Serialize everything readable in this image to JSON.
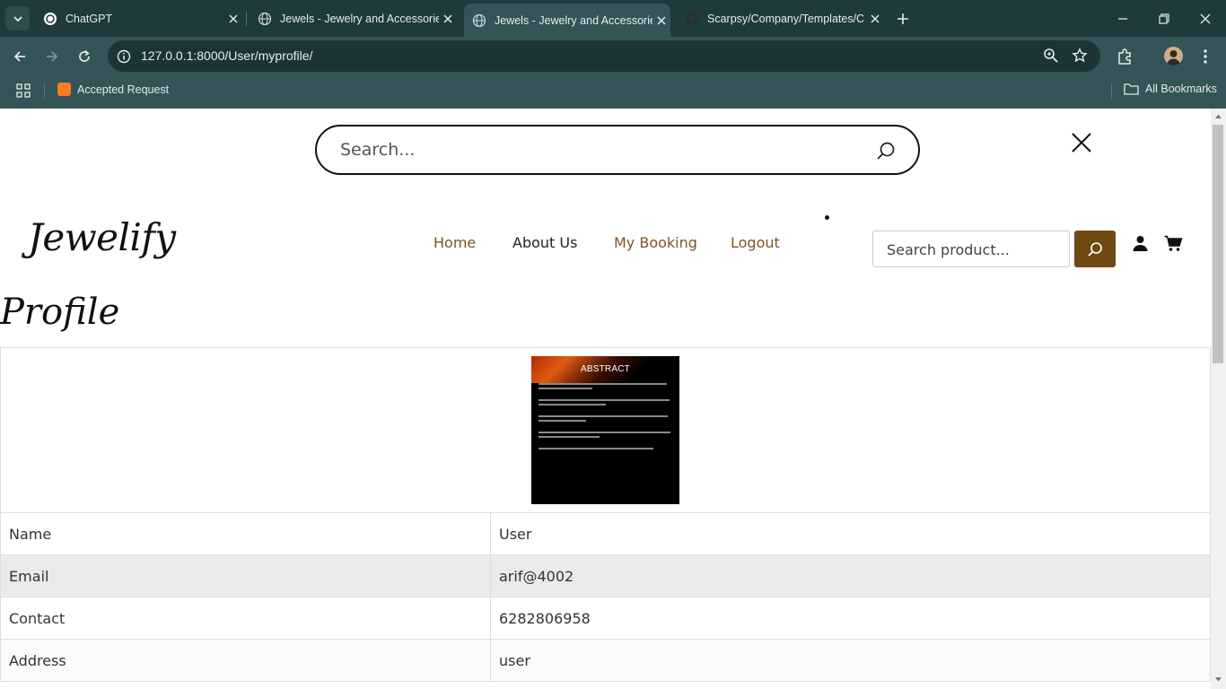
{
  "browser": {
    "tabs": [
      {
        "title": "ChatGPT",
        "icon": "chatgpt-icon",
        "active": false
      },
      {
        "title": "Jewels - Jewelry and Accessories",
        "icon": "globe-icon",
        "active": false
      },
      {
        "title": "Jewels - Jewelry and Accessories",
        "icon": "globe-icon",
        "active": true
      },
      {
        "title": "Scarpsy/Company/Templates/C",
        "icon": "github-icon",
        "active": false
      }
    ],
    "url": "127.0.0.1:8000/User/myprofile/",
    "bookmarks": [
      {
        "label": "Accepted Request",
        "icon": "xampp-icon"
      }
    ],
    "all_bookmarks_label": "All Bookmarks"
  },
  "overlay": {
    "search_placeholder": "Search..."
  },
  "header": {
    "logo": "Jewelify",
    "nav": [
      {
        "label": "Home"
      },
      {
        "label": "About Us"
      },
      {
        "label": "My Booking"
      },
      {
        "label": "Logout"
      }
    ],
    "product_search_placeholder": "Search product..."
  },
  "profile": {
    "title": "Profile",
    "image": {
      "heading": "ABSTRACT"
    },
    "rows": [
      {
        "label": "Name",
        "value": "User"
      },
      {
        "label": "Email",
        "value": "arif@4002"
      },
      {
        "label": "Contact",
        "value": "6282806958"
      },
      {
        "label": "Address",
        "value": "user"
      }
    ]
  },
  "colors": {
    "accent": "#6e4a12",
    "nav_link": "#7a5522",
    "chrome_bg": "#1f3a3d",
    "toolbar_bg": "#345457"
  }
}
